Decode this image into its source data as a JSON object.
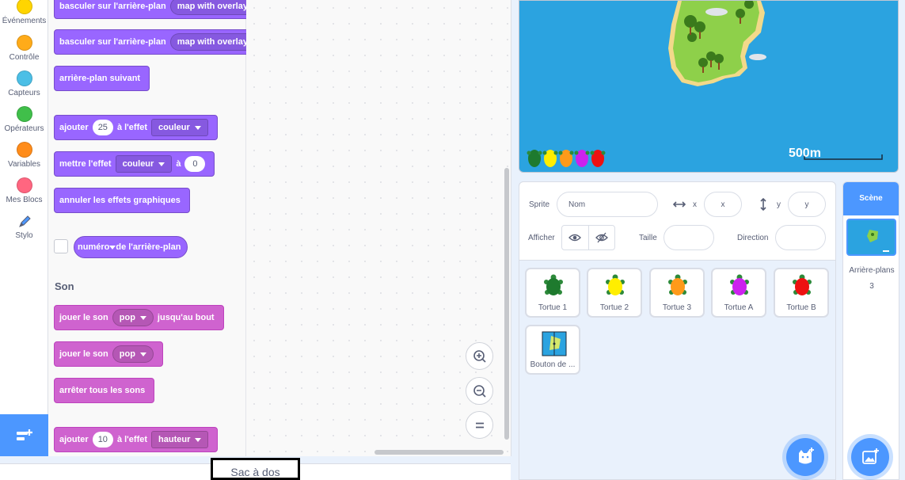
{
  "categories": [
    {
      "label": "Événements",
      "color": "#ffd500"
    },
    {
      "label": "Contrôle",
      "color": "#ffab19"
    },
    {
      "label": "Capteurs",
      "color": "#4cbfe6"
    },
    {
      "label": "Opérateurs",
      "color": "#40bf4a"
    },
    {
      "label": "Variables",
      "color": "#ff8c1a"
    },
    {
      "label": "Mes Blocs",
      "color": "#ff6680"
    },
    {
      "label": "Stylo",
      "icon": "pen-icon"
    }
  ],
  "palette": {
    "blocks_looks": [
      {
        "text": "basculer sur l'arrière-plan",
        "dropdown": "map with overlay"
      },
      {
        "text": "basculer sur l'arrière-plan",
        "dropdown": "map with overlay"
      },
      {
        "text": "arrière-plan suivant"
      },
      {
        "text1": "ajouter",
        "value": "25",
        "text2": "à l'effet",
        "dropdown": "couleur"
      },
      {
        "text1": "mettre l'effet",
        "dropdown": "couleur",
        "text2": "à",
        "value": "0"
      },
      {
        "text": "annuler les effets graphiques"
      }
    ],
    "reporter": {
      "dropdown": "numéro",
      "text": "de l'arrière-plan"
    },
    "sound_heading": "Son",
    "blocks_sound": [
      {
        "text1": "jouer le son",
        "dropdown": "pop",
        "text2": "jusqu'au bout"
      },
      {
        "text1": "jouer le son",
        "dropdown": "pop"
      },
      {
        "text": "arrêter tous les sons"
      },
      {
        "text1": "ajouter",
        "value": "10",
        "text2": "à l'effet",
        "dropdown": "hauteur"
      }
    ]
  },
  "backpack": {
    "label": "Sac à dos"
  },
  "stage": {
    "scale_label": "500m"
  },
  "sprite_info": {
    "sprite_label": "Sprite",
    "name_placeholder": "Nom",
    "x_label": "x",
    "x_placeholder": "x",
    "y_label": "y",
    "y_placeholder": "y",
    "show_label": "Afficher",
    "size_label": "Taille",
    "direction_label": "Direction"
  },
  "sprites": [
    {
      "name": "Tortue 1",
      "color": "#1e7a2e"
    },
    {
      "name": "Tortue 2",
      "color": "#ffee00"
    },
    {
      "name": "Tortue 3",
      "color": "#ff9a1a"
    },
    {
      "name": "Tortue A",
      "color": "#cc22ee"
    },
    {
      "name": "Tortue B",
      "color": "#ee1111"
    },
    {
      "name": "Bouton de ..."
    }
  ],
  "stage_pane": {
    "header": "Scène",
    "backdrops_label": "Arrière-plans",
    "backdrops_count": "3"
  }
}
